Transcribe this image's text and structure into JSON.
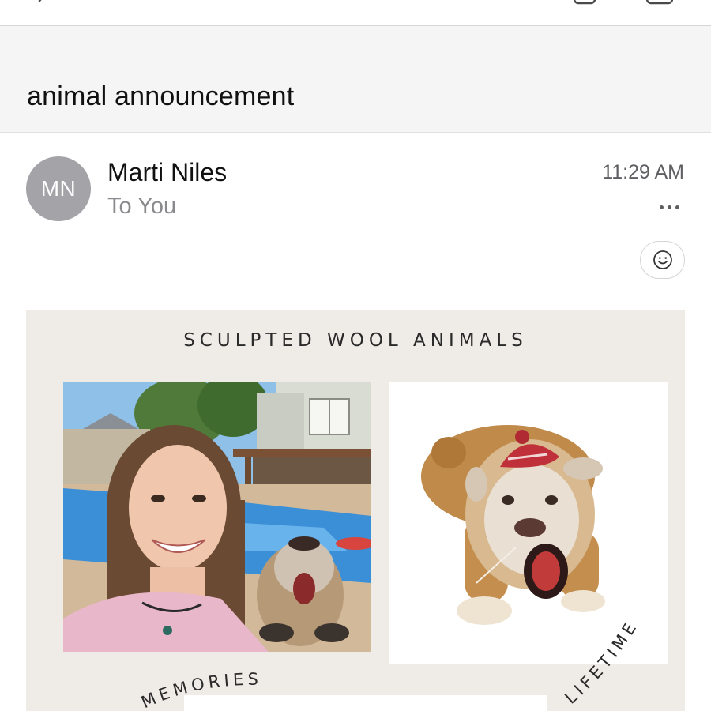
{
  "email": {
    "subject": "animal announcement",
    "avatar_initials": "MN",
    "sender": "Marti Niles",
    "recipient": "To You",
    "time": "11:29 AM"
  },
  "flyer": {
    "title": "SCULPTED WOOL ANIMALS",
    "arc_left": "MEMORIES",
    "arc_right": "LIFETIME"
  },
  "icons": {
    "back": "chevron-left-icon",
    "more": "more-horizontal-icon",
    "react": "smiley-icon"
  },
  "colors": {
    "avatar": "#a4a4a8",
    "subject_bar": "#f5f5f5",
    "flyer_bg": "#efebe6"
  }
}
